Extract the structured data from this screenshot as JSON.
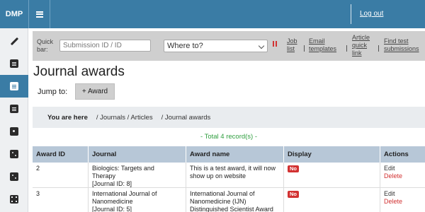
{
  "app": {
    "brand": "DMP",
    "logout_label": "Log out"
  },
  "quick_bar": {
    "label": "Quick bar:",
    "search_placeholder": "Submission ID / ID",
    "where_to_value": "Where to?",
    "links": [
      {
        "label": "Job\nlist"
      },
      {
        "label": "Email\ntemplates"
      },
      {
        "label": "Article\nquick\nlink"
      },
      {
        "label": "Find test\nsubmissions"
      }
    ]
  },
  "page": {
    "title": "Journal awards",
    "jump_to_label": "Jump to:",
    "add_award_label": "+ Award"
  },
  "breadcrumb": {
    "here_label": "You are here",
    "items": [
      "/ Journals / Articles",
      "/ Journal awards"
    ]
  },
  "total_text": "- Total 4 record(s) -",
  "table": {
    "headers": [
      "Award ID",
      "Journal",
      "Award name",
      "Display",
      "Actions"
    ],
    "rows": [
      {
        "award_id": "2",
        "journal": "Biologics: Targets and\nTherapy\n[Journal ID: 8]",
        "award_name": "This is a test award, it will now\nshow up on website",
        "display": "No",
        "edit": "Edit",
        "delete": "Delete"
      },
      {
        "award_id": "3",
        "journal": "International Journal of\nNanomedicine\n[Journal ID: 5]",
        "award_name": "International Journal of\nNanomedicine (IJN)\nDistinguished Scientist Award",
        "display": "No",
        "edit": "Edit",
        "delete": "Delete"
      }
    ]
  },
  "colors": {
    "primary": "#3a7ca5",
    "danger": "#d23232",
    "success": "#2e9e3e",
    "table_header": "#b7c7d7"
  },
  "sidebar": {
    "items": [
      {
        "icon": "pencil-icon"
      },
      {
        "icon": "document-icon"
      },
      {
        "icon": "journal-icon",
        "active": true
      },
      {
        "icon": "book-icon"
      },
      {
        "icon": "dice-one-icon"
      },
      {
        "icon": "dice-two-icon"
      },
      {
        "icon": "dice-three-icon"
      },
      {
        "icon": "dice-four-icon"
      }
    ]
  }
}
